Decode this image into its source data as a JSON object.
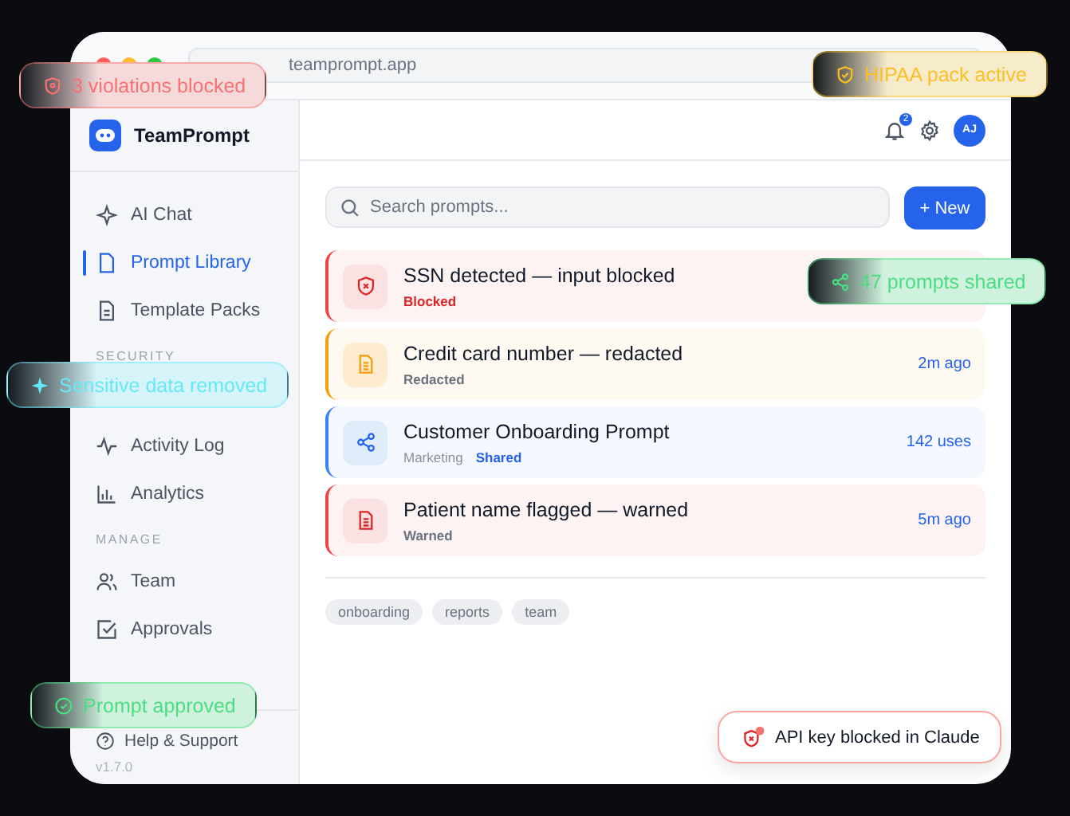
{
  "browser": {
    "url": "teamprompt.app"
  },
  "app": {
    "name": "TeamPrompt"
  },
  "header": {
    "notifications": "2",
    "avatar": "AJ"
  },
  "sidebar": {
    "sections": [
      {
        "items": [
          {
            "label": "AI Chat",
            "selected": false
          },
          {
            "label": "Prompt Library",
            "selected": true
          },
          {
            "label": "Template Packs",
            "selected": false
          }
        ]
      },
      {
        "heading": "SECURITY",
        "items": [
          {
            "label": "Activity Log",
            "selected": false
          },
          {
            "label": "Analytics",
            "selected": false
          }
        ]
      },
      {
        "heading": "MANAGE",
        "items": [
          {
            "label": "Team",
            "selected": false
          },
          {
            "label": "Approvals",
            "selected": false
          }
        ]
      }
    ],
    "help": "Help & Support",
    "version": "v1.7.0"
  },
  "search": {
    "placeholder": "Search prompts..."
  },
  "new_button": "+ New",
  "rows": [
    {
      "kind": "blocked",
      "title": "SSN detected — input blocked",
      "status": "Blocked"
    },
    {
      "kind": "redacted",
      "title": "Credit card number — redacted",
      "status": "Redacted",
      "meta": "2m ago"
    },
    {
      "kind": "shared",
      "title": "Customer Onboarding Prompt",
      "category": "Marketing",
      "status": "Shared",
      "meta": "142 uses"
    },
    {
      "kind": "warned",
      "title": "Patient name flagged — warned",
      "status": "Warned",
      "meta": "5m ago"
    }
  ],
  "tags": [
    "onboarding",
    "reports",
    "team"
  ],
  "toast": {
    "text": "API key blocked in Claude"
  },
  "badges": [
    {
      "kind": "shield",
      "text": "3 violations blocked",
      "color": "#f87171"
    },
    {
      "kind": "shield-check",
      "text": "HIPAA pack active",
      "color": "#fbbf24"
    },
    {
      "kind": "share",
      "text": "47 prompts shared",
      "color": "#4ade80"
    },
    {
      "kind": "sparkle",
      "text": "Sensitive data removed",
      "color": "#67e8f9"
    },
    {
      "kind": "check",
      "text": "Prompt approved",
      "color": "#4ade80"
    }
  ]
}
